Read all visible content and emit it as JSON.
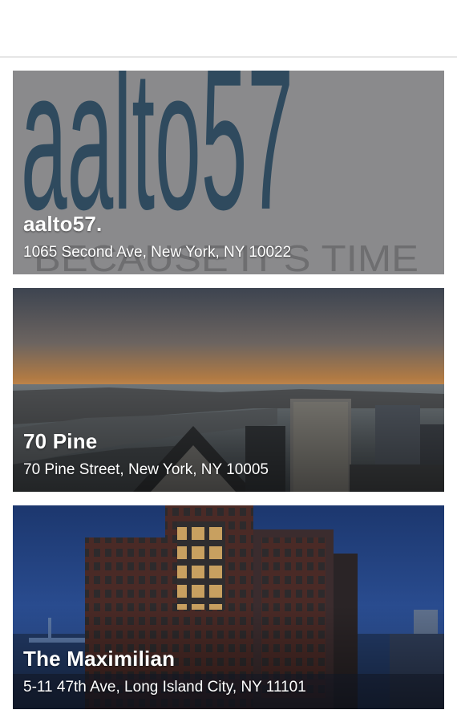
{
  "buildings": [
    {
      "name": "aalto57.",
      "address": "1065 Second Ave, New York, NY 10022",
      "logo_text": "aalto57",
      "logo_tagline": "BECAUSE IT'S TIME"
    },
    {
      "name": "70 Pine",
      "address": "70 Pine Street, New York, NY 10005"
    },
    {
      "name": "The Maximilian",
      "address": "5-11 47th Ave, Long Island City, NY 11101"
    }
  ],
  "colors": {
    "logo_tile": "#8a8a8c",
    "logo_letters": "#2f4a5e",
    "logo_numerals": "#5c5e60",
    "dusk_sky_top": "#3d4450",
    "dusk_horizon": "#b07a44",
    "night_sky": "#1e3c78"
  }
}
